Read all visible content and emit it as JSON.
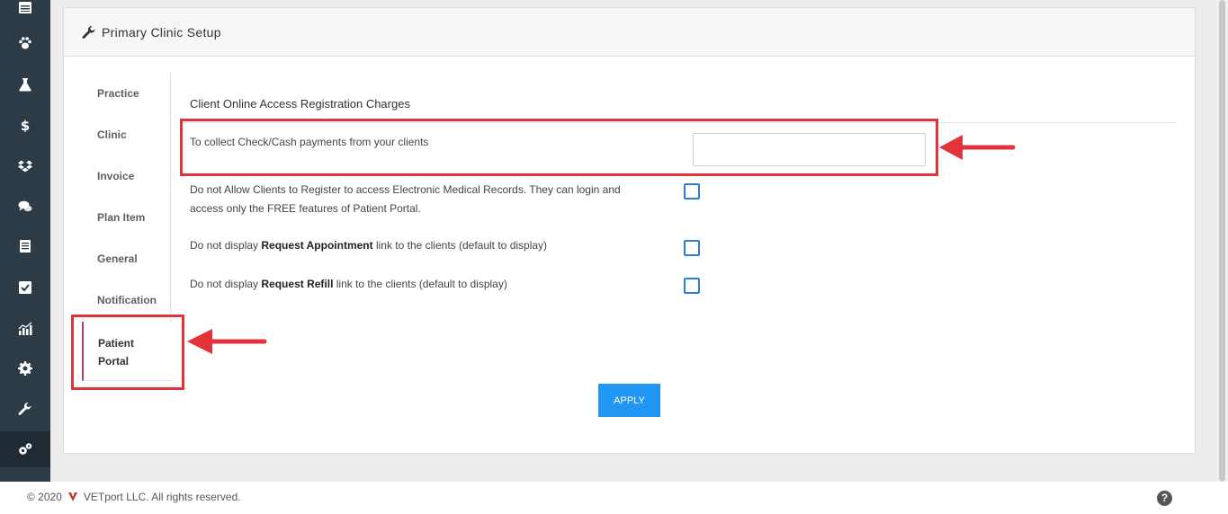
{
  "sidebar": {
    "icons": [
      "calendar-icon",
      "paw-icon",
      "flask-icon",
      "dollar-icon",
      "dropbox-icon",
      "chat-icon",
      "ledger-icon",
      "checkbox-icon",
      "chart-icon",
      "gear-icon",
      "wrench-icon",
      "cogs-icon"
    ]
  },
  "panel": {
    "title": "Primary Clinic Setup"
  },
  "tabs": [
    {
      "label": "Practice"
    },
    {
      "label": "Clinic"
    },
    {
      "label": "Invoice"
    },
    {
      "label": "Plan Item"
    },
    {
      "label": "General"
    },
    {
      "label": "Notification"
    }
  ],
  "active_tab": {
    "line1": "Patient",
    "line2": "Portal"
  },
  "form": {
    "section_title": "Client Online Access Registration Charges",
    "check_cash_label": "To collect Check/Cash payments from your clients",
    "check_cash_value": "",
    "no_register_label_1": "Do not Allow Clients to Register to access Electronic Medical Records. They can login and",
    "no_register_label_2": "access only the FREE features of Patient Portal.",
    "appt_prefix": "Do not display ",
    "appt_bold": "Request Appointment",
    "appt_suffix": " link to the clients (default to display)",
    "refill_prefix": "Do not display ",
    "refill_bold": "Request Refill",
    "refill_suffix": " link to the clients (default to display)",
    "apply_label": "APPLY"
  },
  "footer": {
    "copyright": "© 2020",
    "company": "VETport LLC. All rights reserved.",
    "help": "?"
  },
  "colors": {
    "sidebar_bg": "#2c3b45",
    "accent_blue": "#2196f3",
    "annotation_red": "#e2333c",
    "active_tab_border": "#b63a7a"
  }
}
